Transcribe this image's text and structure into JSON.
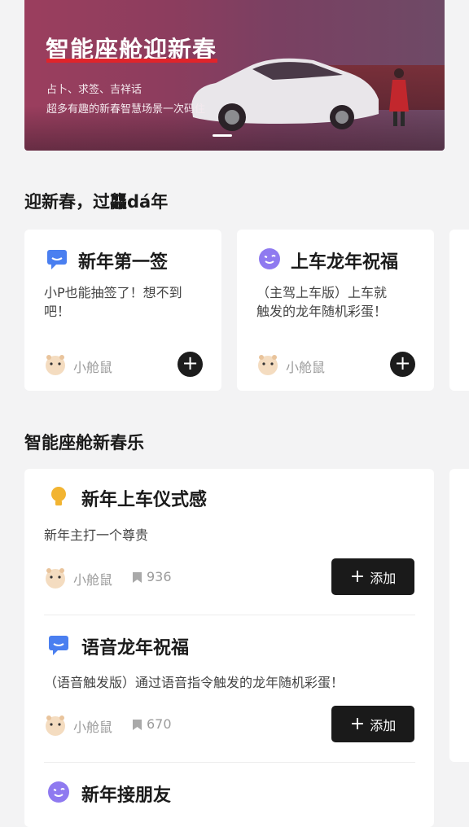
{
  "banner": {
    "title": "智能座舱迎新春",
    "line1": "占卜、求签、吉祥话",
    "line2": "超多有趣的新春智慧场景一次码住"
  },
  "section1": {
    "title": "迎新春，过龘dá年",
    "cards": [
      {
        "icon": "chat-bubble-icon",
        "title": "新年第一签",
        "desc_line1": "小P也能抽签了！想不到",
        "desc_line2": "吧！",
        "author": "小舱鼠",
        "add": "+"
      },
      {
        "icon": "wink-face-icon",
        "title": "上车龙年祝福",
        "desc_line1": "（主驾上车版）上车就",
        "desc_line2": "触发的龙年随机彩蛋！",
        "author": "小舱鼠",
        "add": "+"
      }
    ]
  },
  "section2": {
    "title": "智能座舱新春乐",
    "items": [
      {
        "icon": "lightbulb-icon",
        "title": "新年上车仪式感",
        "desc": "新年主打一个尊贵",
        "author": "小舱鼠",
        "count": "936",
        "add_label": "添加"
      },
      {
        "icon": "chat-bubble-icon",
        "title": "语音龙年祝福",
        "desc": "（语音触发版）通过语音指令触发的龙年随机彩蛋！",
        "author": "小舱鼠",
        "count": "670",
        "add_label": "添加"
      },
      {
        "icon": "wink-face-icon",
        "title": "新年接朋友"
      }
    ]
  },
  "colors": {
    "accent_dark": "#1a1a1a",
    "banner_red": "#e0242b",
    "icon_blue": "#4a7ff0",
    "icon_purple": "#8f7af0",
    "icon_yellow": "#f2b431"
  }
}
